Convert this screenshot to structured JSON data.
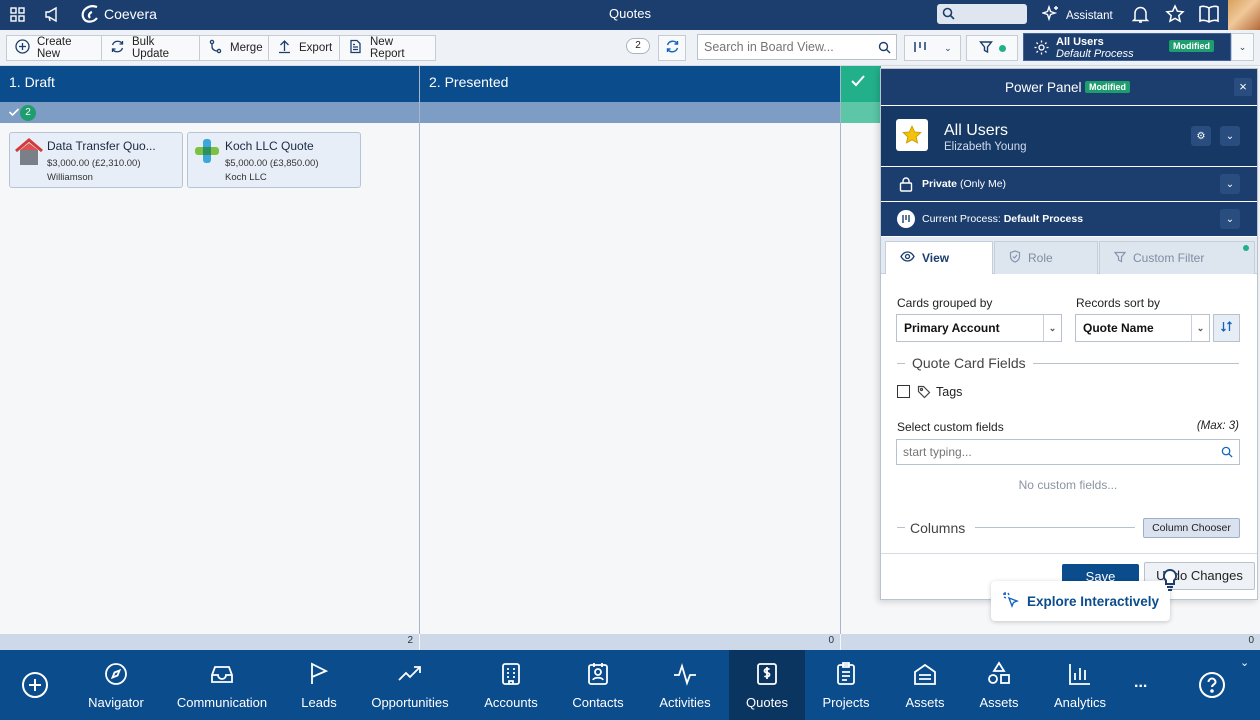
{
  "app": {
    "brand": "Coevera",
    "title": "Quotes",
    "assistant": "Assistant"
  },
  "view_selector": {
    "name": "All Users",
    "process": "Default Process",
    "badge": "Modified"
  },
  "toolbar": {
    "create_new": "Create New",
    "bulk_update": "Bulk Update",
    "merge": "Merge",
    "export": "Export",
    "new_report": "New Report",
    "count": "2",
    "search_placeholder": "Search in Board View..."
  },
  "columns": [
    {
      "title": "1. Draft",
      "count": "2",
      "footer": "2"
    },
    {
      "title": "2. Presented",
      "footer": "0"
    },
    {
      "footer": "0"
    }
  ],
  "cards": [
    {
      "title": "Data Transfer Quo...",
      "amount": "$3,000.00 (£2,310.00)",
      "company": "Williamson"
    },
    {
      "title": "Koch LLC Quote",
      "amount": "$5,000.00 (£3,850.00)",
      "company": "Koch LLC"
    }
  ],
  "power_panel": {
    "title": "Power Panel",
    "badge": "Modified",
    "view_name": "All Users",
    "user": "Elizabeth Young",
    "privacy_bold": "Private",
    "privacy_rest": " (Only Me)",
    "process_label": "Current Process: ",
    "process_value": "Default Process",
    "tabs": {
      "view": "View",
      "role": "Role",
      "custom_filter": "Custom Filter"
    },
    "grouped_label": "Cards grouped by",
    "grouped_value": "Primary Account",
    "sort_label": "Records sort by",
    "sort_value": "Quote Name",
    "card_fields_heading": "Quote Card Fields",
    "tags_label": "Tags",
    "custom_fields_label": "Select custom fields",
    "max_label": "(Max: 3)",
    "custom_placeholder": "start typing...",
    "no_fields": "No custom fields...",
    "columns_heading": "Columns",
    "column_chooser": "Column Chooser",
    "save": "Save",
    "undo": "Undo Changes"
  },
  "explore": "Explore Interactively",
  "bottom_nav": [
    {
      "label": "Navigator",
      "icon": "compass-icon"
    },
    {
      "label": "Communication",
      "icon": "inbox-icon"
    },
    {
      "label": "Leads",
      "icon": "flag-icon"
    },
    {
      "label": "Opportunities",
      "icon": "trend-icon"
    },
    {
      "label": "Accounts",
      "icon": "building-icon"
    },
    {
      "label": "Contacts",
      "icon": "contact-icon"
    },
    {
      "label": "Activities",
      "icon": "pulse-icon"
    },
    {
      "label": "Quotes",
      "icon": "quote-icon"
    },
    {
      "label": "Projects",
      "icon": "clipboard-icon"
    },
    {
      "label": "Assets",
      "icon": "asset-icon"
    },
    {
      "label": "Assets",
      "icon": "shapes-icon"
    },
    {
      "label": "Analytics",
      "icon": "chart-icon"
    }
  ],
  "more": "...",
  "colors": {
    "navy": "#1c3e6e",
    "blue": "#0a4c8c",
    "green": "#1e9d6f",
    "teal": "#22b08a"
  }
}
